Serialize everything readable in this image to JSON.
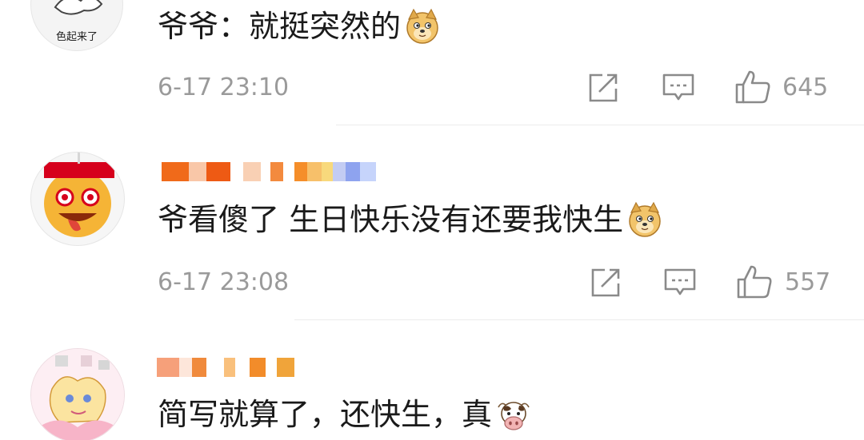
{
  "comments": [
    {
      "avatar_text": "色起来了",
      "text": "爷爷：就挺突然的",
      "emoji": "doge-emoji",
      "time": "6-17 23:10",
      "likes": "645"
    },
    {
      "text": "爷看傻了 生日快乐没有还要我快生",
      "emoji": "doge-emoji",
      "time": "6-17 23:08",
      "likes": "557"
    },
    {
      "text": "简写就算了，还快生，真",
      "emoji": "cow-emoji"
    }
  ],
  "icons": {
    "repost": "repost-icon",
    "reply": "comment-icon",
    "like": "thumbs-up-icon"
  },
  "colors": {
    "text": "#1a1a1a",
    "meta": "#9a9a9a",
    "divider": "#ececec"
  }
}
